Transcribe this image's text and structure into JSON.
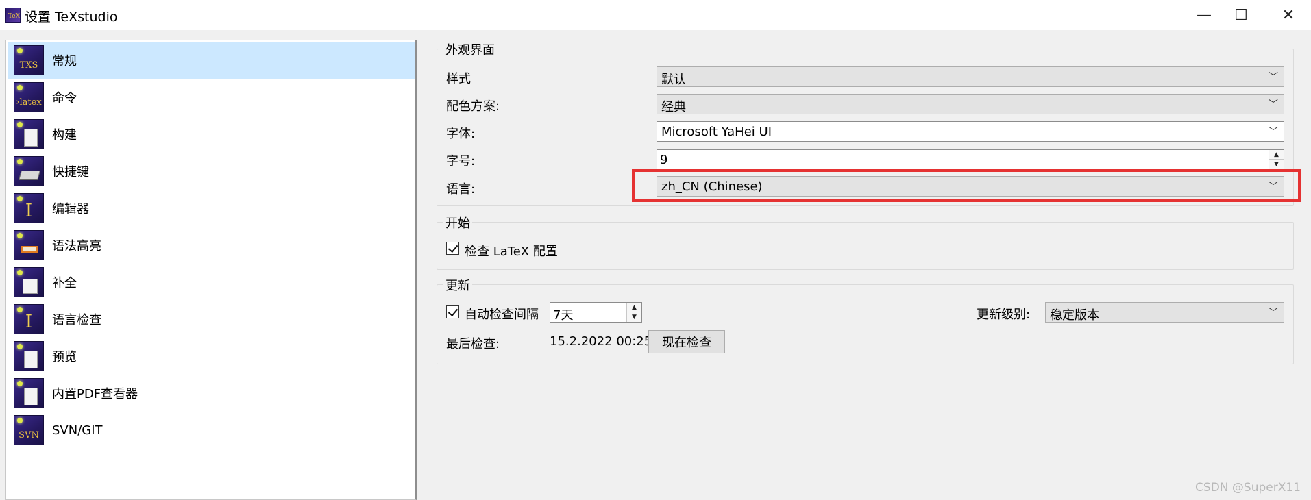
{
  "window": {
    "title": "设置 TeXstudio",
    "icon_label": "TeX",
    "minimize_glyph": "—",
    "maximize_glyph": "☐",
    "close_glyph": "✕"
  },
  "nav": {
    "items": [
      {
        "label": "常规",
        "icon": "txs-general-icon",
        "icon_text": "TXS",
        "selected": true
      },
      {
        "label": "命令",
        "icon": "latex-command-icon",
        "icon_text": "›latex",
        "selected": false
      },
      {
        "label": "构建",
        "icon": "build-icon",
        "icon_text": "",
        "selected": false
      },
      {
        "label": "快捷键",
        "icon": "keyboard-shortcut-icon",
        "icon_text": "",
        "selected": false
      },
      {
        "label": "编辑器",
        "icon": "editor-cursor-icon",
        "icon_text": "",
        "selected": false
      },
      {
        "label": "语法高亮",
        "icon": "syntax-highlight-icon",
        "icon_text": "",
        "selected": false
      },
      {
        "label": "补全",
        "icon": "completion-icon",
        "icon_text": "",
        "selected": false
      },
      {
        "label": "语言检查",
        "icon": "language-check-icon",
        "icon_text": "",
        "selected": false
      },
      {
        "label": "预览",
        "icon": "preview-icon",
        "icon_text": "",
        "selected": false
      },
      {
        "label": "内置PDF查看器",
        "icon": "pdf-viewer-icon",
        "icon_text": "",
        "selected": false
      },
      {
        "label": "SVN/GIT",
        "icon": "svn-git-icon",
        "icon_text": "SVN",
        "selected": false
      }
    ]
  },
  "appearance": {
    "title": "外观界面",
    "style_label": "样式",
    "style_value": "默认",
    "color_scheme_label": "配色方案:",
    "color_scheme_value": "经典",
    "font_label": "字体:",
    "font_value": "Microsoft YaHei UI",
    "font_size_label": "字号:",
    "font_size_value": "9",
    "language_label": "语言:",
    "language_value": "zh_CN  (Chinese)"
  },
  "startup": {
    "title": "开始",
    "check_latex_label": "检查 LaTeX 配置",
    "check_latex_checked": true
  },
  "updates": {
    "title": "更新",
    "auto_check_label": "自动检查间隔",
    "auto_check_checked": true,
    "interval_value": "7天",
    "level_label": "更新级别:",
    "level_value": "稳定版本",
    "last_check_label": "最后检查:",
    "last_check_value": "15.2.2022 00:25",
    "check_now_label": "现在检查"
  },
  "watermark": "CSDN @SuperX11",
  "colors": {
    "selection": "#cce8ff",
    "highlight_border": "#e53232",
    "icon_bg": "#2a1c70"
  }
}
